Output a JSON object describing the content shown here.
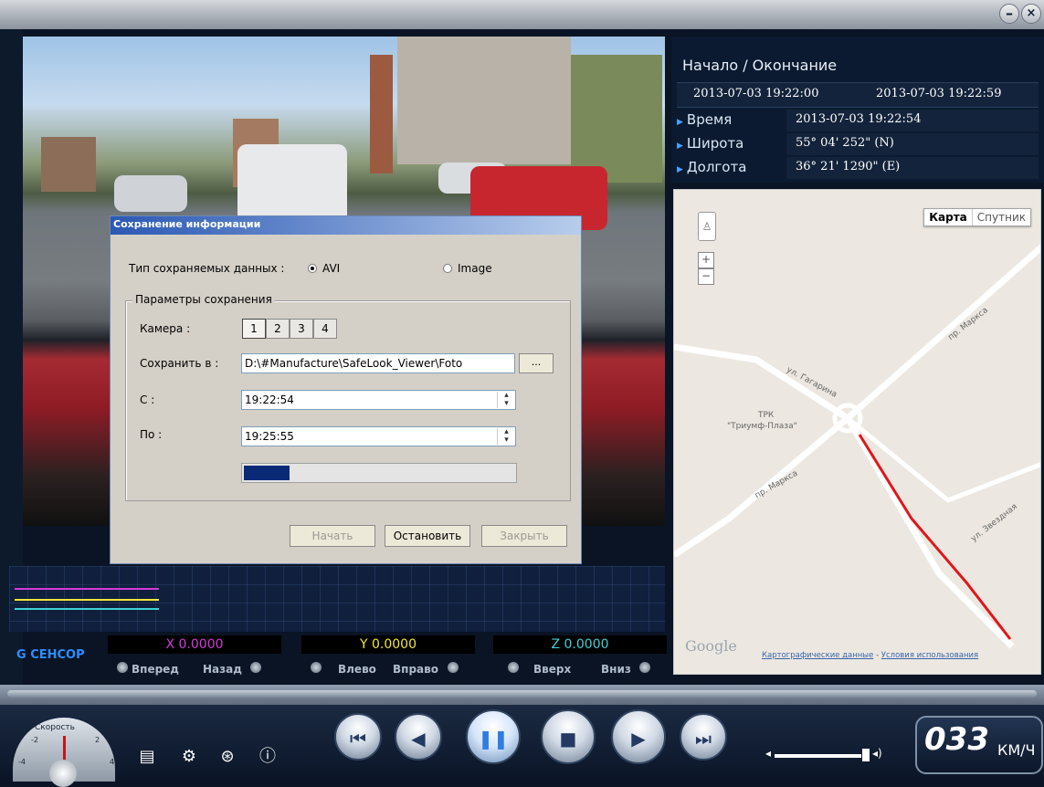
{
  "window": {
    "minimize": "–",
    "close": "×"
  },
  "info": {
    "title": "Начало / Окончание",
    "start": "2013-07-03 19:22:00",
    "end": "2013-07-03 19:22:59",
    "rows": [
      {
        "label": "Время",
        "value": "2013-07-03 19:22:54"
      },
      {
        "label": "Широта",
        "value": "55° 04' 252\" (N)"
      },
      {
        "label": "Долгота",
        "value": "36° 21' 1290\" (E)"
      }
    ]
  },
  "map": {
    "type_selected": "Карта",
    "type_other": "Спутник",
    "labels": {
      "marksa1": "пр. Маркса",
      "gagarina": "ул. Гагарина",
      "trk": "ТРК",
      "trk_name": "\"Триумф-Плаза\"",
      "marksa2": "пр. Маркса",
      "zvezdnaya": "ул. Звездная"
    },
    "google": "Google",
    "attribution_data": "Картографические данные",
    "attribution_sep": " - ",
    "attribution_terms": "Условия использования"
  },
  "sensor": {
    "label": "G СЕНСОР",
    "x": {
      "value": "X 0.0000",
      "left": "Вперед",
      "right": "Назад",
      "color": "#d23bd8"
    },
    "y": {
      "value": "Y 0.0000",
      "left": "Влево",
      "right": "Вправо",
      "color": "#f1e53a"
    },
    "z": {
      "value": "Z 0.0000",
      "left": "Вверх",
      "right": "Вниз",
      "color": "#3fd0d8"
    }
  },
  "dialog": {
    "title": "Сохранение информации",
    "data_type_label": "Тип сохраняемых данных :",
    "option_avi": "AVI",
    "option_image": "Image",
    "selected": "AVI",
    "group_title": "Параметры сохранения",
    "camera_label": "Камера :",
    "cameras": [
      "1",
      "2",
      "3",
      "4"
    ],
    "camera_selected": "1",
    "save_to_label": "Сохранить в :",
    "save_to_value": "D:\\#Manufacture\\SafeLook_Viewer\\Foto",
    "browse": "...",
    "from_label": "С :",
    "from_value": "19:22:54",
    "to_label": "По :",
    "to_value": "19:25:55",
    "progress": 0.17,
    "btn_start": "Начать",
    "btn_stop": "Остановить",
    "btn_close": "Закрыть"
  },
  "controls": {
    "speed_dial_label": "Скорость",
    "dial_marks": [
      "-2",
      "2",
      "-4",
      "4"
    ],
    "speed_value": "033",
    "speed_unit": "КМ/Ч",
    "icons": [
      "print-icon",
      "gear-icon",
      "film-reel-icon",
      "info-icon"
    ],
    "playback": [
      "skip-back-icon",
      "step-back-icon",
      "pause-icon",
      "stop-icon",
      "play-icon",
      "skip-forward-icon"
    ]
  },
  "colors": {
    "accent": "#2e8cff",
    "route": "#e0161a"
  }
}
